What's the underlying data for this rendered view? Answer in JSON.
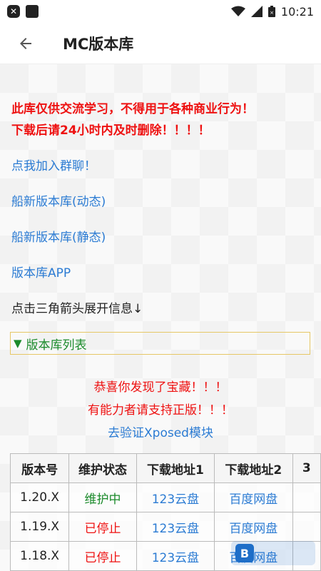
{
  "status_bar": {
    "time": "10:21",
    "icons": [
      "close-box-icon",
      "square-icon",
      "wifi-icon",
      "signal-icon",
      "battery-icon"
    ]
  },
  "app_bar": {
    "back_icon": "arrow-left-icon",
    "title": "MC版本库"
  },
  "notice": {
    "line1": "此库仅供交流学习，不得用于各种商业行为！",
    "line2": "下载后请24小时内及时删除！！！！"
  },
  "links": {
    "join_group": "点我加入群聊！",
    "dynamic": "船新版本库(动态)",
    "static": "船新版本库(静态)",
    "app": "版本库APP"
  },
  "hint": "点击三角箭头展开信息↓",
  "details": {
    "triangle": "▼",
    "summary": "版本库列表"
  },
  "treasure": {
    "line1": "恭喜你发现了宝藏！！！",
    "line2": "有能力者请支持正版！！！",
    "verify_link": "去验证Xposed模块"
  },
  "table": {
    "headers": [
      "版本号",
      "维护状态",
      "下载地址1",
      "下载地址2",
      "3"
    ],
    "rows": [
      {
        "version": "1.20.X",
        "status": "维护中",
        "dl1": "123云盘",
        "dl2": "百度网盘"
      },
      {
        "version": "1.19.X",
        "status": "已停止",
        "dl1": "123云盘",
        "dl2": "百度网盘"
      },
      {
        "version": "1.18.X",
        "status": "已停止",
        "dl1": "123云盘",
        "dl2": "百度网盘"
      }
    ]
  },
  "colors": {
    "warning_red": "#ee1111",
    "link_blue": "#2b7bd3",
    "maintained_green": "#1a8a2a"
  }
}
